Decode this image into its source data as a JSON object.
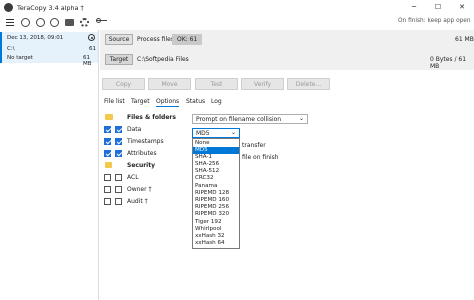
{
  "window": {
    "title": "TeraCopy 3.4 alpha †"
  },
  "toolbar": {
    "on_finish_label": "On finish: keep app open"
  },
  "job": {
    "date": "Dec 13, 2018, 09:01",
    "source_letter": "C:\\",
    "source_count": "61",
    "target": "No target",
    "size": "61 MB"
  },
  "header": {
    "source_button": "Source",
    "process_files_label": "Process files:",
    "ok_badge": "OK: 61",
    "total_size": "61 MB",
    "target_button": "Target",
    "target_path": "C:\\Softpedia Files",
    "bytes_info": "0 Bytes / 61 MB"
  },
  "actions": {
    "copy": "Copy",
    "move": "Move",
    "test": "Test",
    "verify": "Verify",
    "delete": "Delete..."
  },
  "tabs": [
    "File list",
    "Target",
    "Options",
    "Status",
    "Log"
  ],
  "options": {
    "files_folders": "Files & folders",
    "data": "Data",
    "timestamps": "Timestamps",
    "attributes": "Attributes",
    "security": "Security",
    "acl": "ACL",
    "owner": "Owner †",
    "audit": "Audit †"
  },
  "collision_select": "Prompt on filename collision",
  "hash_select": "MD5",
  "side_text": {
    "transfer": "transfer",
    "file_on_finish": "file on finish"
  },
  "hash_options": [
    "None",
    "MD5",
    "SHA-1",
    "SHA-256",
    "SHA-512",
    "CRC32",
    "Panama",
    "RIPEMD 128",
    "RIPEMD 160",
    "RIPEMD 256",
    "RIPEMD 320",
    "Tiger 192",
    "Whirlpool",
    "xxHash 32",
    "xxHash 64"
  ],
  "colors": {
    "accent": "#0078d7",
    "badge_bg": "#c9c9c9",
    "panel_bg": "#e9e9e9",
    "selected": "#0078d7"
  }
}
